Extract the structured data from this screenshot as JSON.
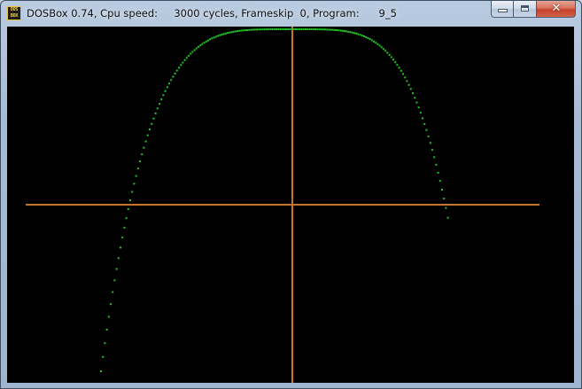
{
  "window": {
    "title": "DOSBox 0.74, Cpu speed:     3000 cycles, Frameskip  0, Program:      9_5",
    "icon_top_text": "DOS",
    "icon_bottom_text": "BOX",
    "buttons": {
      "minimize": "minimize-button",
      "maximize": "maximize-button",
      "close_glyph": "✕"
    }
  },
  "colors": {
    "background": "#000000",
    "axes": "#c8752b",
    "curve": "#22c422",
    "frame": "#a7bcd4"
  },
  "icons": [
    "dosbox-icon",
    "minimize-icon",
    "maximize-icon",
    "close-icon"
  ]
}
